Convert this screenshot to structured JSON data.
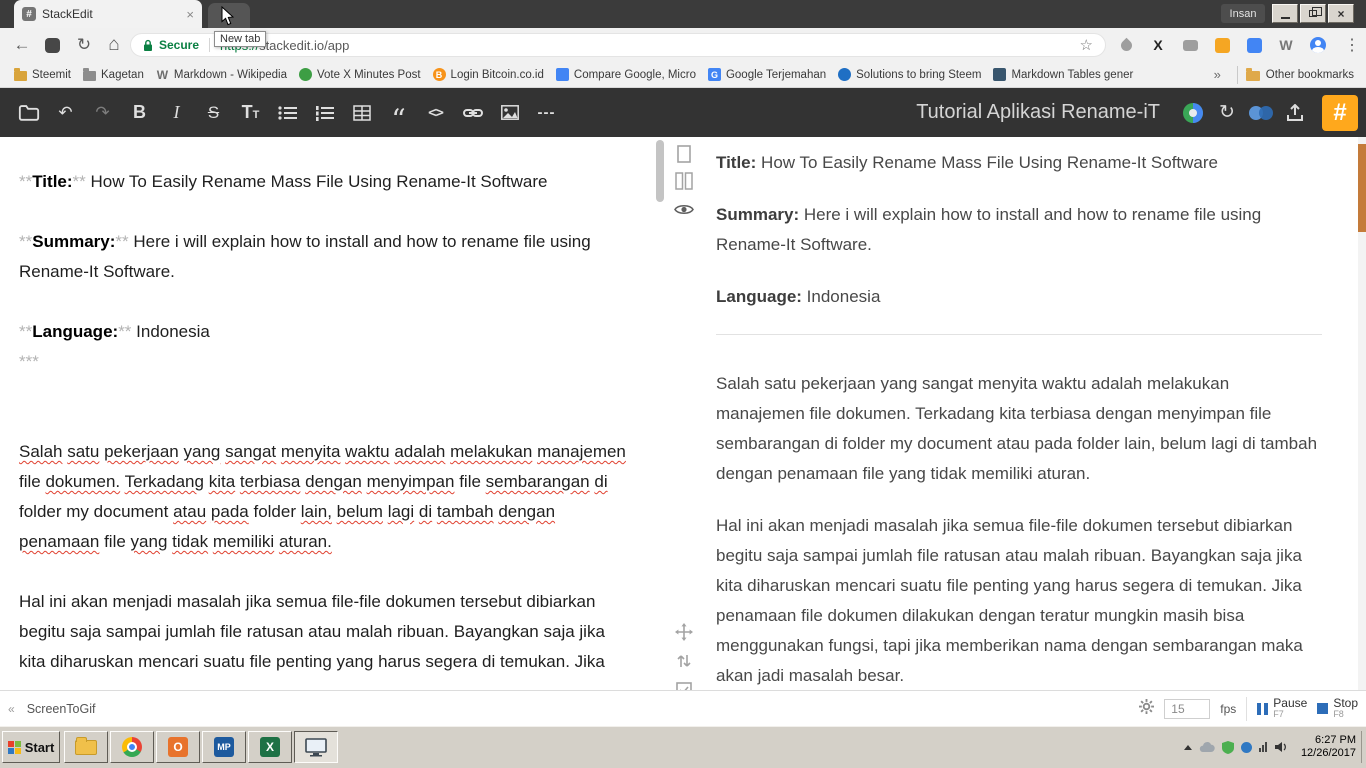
{
  "icons": {
    "back": "←",
    "refresh": "↻",
    "home": "⌂",
    "star": "☆",
    "menu_dots": "⋮",
    "close": "×",
    "overflow_chevron": "»",
    "collapse": "«",
    "wikipedia_letter": "W",
    "x_letter": "X"
  },
  "browser": {
    "tab_title": "StackEdit",
    "new_tab_tooltip": "New tab",
    "profile_button_label": "Insan",
    "address_bar": {
      "secure_label": "Secure",
      "url_scheme": "https://",
      "url_rest": "stackedit.io/app"
    },
    "bookmarks": {
      "items": [
        {
          "label": "Steemit",
          "shape": "folder",
          "color": "#d9a43b"
        },
        {
          "label": "Kagetan",
          "shape": "folder",
          "color": "#8d8d8d"
        },
        {
          "label": "Markdown - Wikipedia",
          "shape": "letter",
          "letter": "W",
          "color": "#6d6d6d"
        },
        {
          "label": "Vote X Minutes Post",
          "shape": "circle",
          "color": "#3d9e44"
        },
        {
          "label": "Login Bitcoin.co.id",
          "shape": "circle",
          "letter": "B",
          "color": "#f7931a"
        },
        {
          "label": "Compare Google, Micro",
          "shape": "square",
          "color": "#4285f4"
        },
        {
          "label": "Google Terjemahan",
          "shape": "square",
          "letter": "G",
          "color": "#4285f4"
        },
        {
          "label": "Solutions to bring Steem",
          "shape": "circle",
          "color": "#1f6fc4"
        },
        {
          "label": "Markdown Tables gener",
          "shape": "square",
          "color": "#39566e"
        }
      ],
      "other_bookmarks_label": "Other bookmarks"
    }
  },
  "stackedit": {
    "document_title": "Tutorial Aplikasi Rename-iT",
    "logo_glyph": "#",
    "toolbar": [
      {
        "name": "folder-icon",
        "kind": "svg"
      },
      {
        "name": "undo-icon",
        "kind": "glyph",
        "glyph": "↶"
      },
      {
        "name": "redo-icon",
        "kind": "glyph",
        "glyph": "↷",
        "disabled": true
      },
      {
        "name": "bold-icon",
        "kind": "glyph",
        "glyph": "B",
        "cls": "g-bold"
      },
      {
        "name": "italic-icon",
        "kind": "glyph",
        "glyph": "I",
        "cls": "g-italic"
      },
      {
        "name": "strikethrough-icon",
        "kind": "glyph",
        "glyph": "S",
        "cls": "g-strike"
      },
      {
        "name": "font-size-icon",
        "kind": "double",
        "glyph": "T",
        "glyph_small": "T"
      },
      {
        "name": "unordered-list-icon",
        "kind": "svg"
      },
      {
        "name": "ordered-list-icon",
        "kind": "svg"
      },
      {
        "name": "table-icon",
        "kind": "svg"
      },
      {
        "name": "blockquote-icon",
        "kind": "glyph",
        "glyph": "“",
        "cls": "g-quote"
      },
      {
        "name": "code-icon",
        "kind": "glyph",
        "glyph": "<>",
        "cls": "g-code"
      },
      {
        "name": "link-icon",
        "kind": "svg"
      },
      {
        "name": "image-icon",
        "kind": "svg"
      },
      {
        "name": "horizontal-rule-icon",
        "kind": "glyph",
        "glyph": "---",
        "cls": "g-hr"
      }
    ],
    "sync_glyph": "↻"
  },
  "editor": {
    "spellcheck_exceptions": [
      "file",
      "folder",
      "my",
      "document",
      "file-file"
    ],
    "blocks": [
      {
        "kind": "meta",
        "marker": "**",
        "label": "Title:",
        "text": " How To Easily Rename Mass File Using Rename-It Software"
      },
      {
        "kind": "blank"
      },
      {
        "kind": "meta",
        "marker": "**",
        "label": "Summary:",
        "text": " Here i will explain how to install and how to rename file using Rename-It Software."
      },
      {
        "kind": "blank"
      },
      {
        "kind": "meta",
        "marker": "**",
        "label": "Language:",
        "text": " Indonesia"
      },
      {
        "kind": "marker",
        "text": "***"
      },
      {
        "kind": "blank"
      },
      {
        "kind": "blank"
      },
      {
        "kind": "para",
        "spellcheck": true,
        "text": "Salah satu pekerjaan yang sangat menyita waktu adalah melakukan manajemen file dokumen. Terkadang kita terbiasa dengan menyimpan file sembarangan di folder my document atau pada folder lain, belum lagi di tambah dengan penamaan file yang tidak memiliki aturan."
      },
      {
        "kind": "blank"
      },
      {
        "kind": "para",
        "spellcheck": false,
        "text": "Hal ini akan menjadi masalah jika semua file-file dokumen tersebut dibiarkan begitu saja sampai jumlah file ratusan atau malah ribuan. Bayangkan saja jika kita diharuskan mencari suatu file penting yang harus segera di temukan. Jika"
      }
    ]
  },
  "preview": {
    "blocks": [
      {
        "kind": "labeled",
        "label": "Title:",
        "text": " How To Easily Rename Mass File Using Rename-It Software"
      },
      {
        "kind": "labeled",
        "label": "Summary:",
        "text": " Here i will explain how to install and how to rename file using Rename-It Software."
      },
      {
        "kind": "labeled",
        "label": "Language:",
        "text": " Indonesia"
      },
      {
        "kind": "hr"
      },
      {
        "kind": "para",
        "text": "Salah satu pekerjaan yang sangat menyita waktu adalah melakukan manajemen file dokumen. Terkadang kita terbiasa dengan menyimpan file sembarangan di folder my document atau pada folder lain, belum lagi di tambah dengan penamaan file yang tidak memiliki aturan."
      },
      {
        "kind": "para",
        "text": "Hal ini akan menjadi masalah jika semua file-file dokumen tersebut dibiarkan begitu saja sampai jumlah file ratusan atau malah ribuan. Bayangkan saja jika kita diharuskan mencari suatu file penting yang harus segera di temukan. Jika penamaan file dokumen dilakukan dengan teratur mungkin masih bisa menggunakan fungsi, tapi jika memberikan nama dengan sembarangan maka akan jadi masalah besar."
      }
    ]
  },
  "recorder": {
    "app_name": "ScreenToGif",
    "fps_value": "15",
    "fps_label": "fps",
    "pause": {
      "label": "Pause",
      "key": "F7"
    },
    "stop": {
      "label": "Stop",
      "key": "F8"
    }
  },
  "taskbar": {
    "start_label": "Start",
    "quick_launch": [
      {
        "name": "file-explorer-button",
        "icon": "folder"
      },
      {
        "name": "chrome-button",
        "icon": "chrome"
      },
      {
        "name": "outlook-button",
        "icon": "letter",
        "letter": "O",
        "color": "#e8732c"
      },
      {
        "name": "mp-app-button",
        "icon": "letter",
        "letter": "MP",
        "color": "#1d5a9e",
        "font": "9"
      },
      {
        "name": "excel-button",
        "icon": "letter",
        "letter": "X",
        "color": "#1e7145"
      },
      {
        "name": "screen-recorder-button",
        "icon": "monitor",
        "pressed": true
      }
    ],
    "clock": {
      "time": "6:27 PM",
      "date": "12/26/2017"
    }
  },
  "colors": {
    "accent_logo": "#ffa81c",
    "preview_scrollbar": "#c47b3a",
    "secure_green": "#0b8043",
    "recorder_blue": "#2d6db8"
  }
}
